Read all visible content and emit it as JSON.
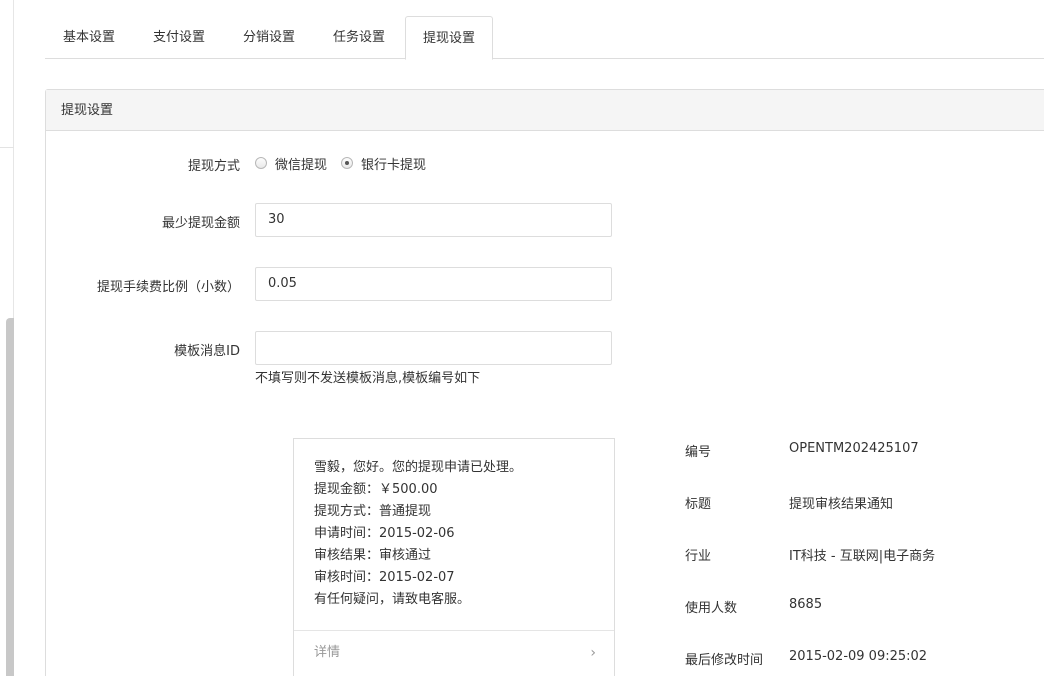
{
  "tabs": [
    {
      "label": "基本设置"
    },
    {
      "label": "支付设置"
    },
    {
      "label": "分销设置"
    },
    {
      "label": "任务设置"
    },
    {
      "label": "提现设置"
    }
  ],
  "active_tab": "提现设置",
  "panel": {
    "title": "提现设置"
  },
  "form": {
    "method": {
      "label": "提现方式",
      "options": [
        {
          "label": "微信提现",
          "checked": false
        },
        {
          "label": "银行卡提现",
          "checked": true
        }
      ]
    },
    "min_amount": {
      "label": "最少提现金额",
      "value": "30"
    },
    "fee_ratio": {
      "label": "提现手续费比例（小数）",
      "value": "0.05"
    },
    "template_id": {
      "label": "模板消息ID",
      "value": "",
      "help": "不填写则不发送模板消息,模板编号如下"
    }
  },
  "preview": {
    "lines": [
      "雪毅，您好。您的提现申请已处理。",
      "提现金额：￥500.00",
      "提现方式：普通提现",
      "申请时间：2015-02-06",
      "审核结果：审核通过",
      "审核时间：2015-02-07",
      "有任何疑问，请致电客服。"
    ],
    "detail_label": "详情"
  },
  "template_info": [
    {
      "key": "编号",
      "value": "OPENTM202425107"
    },
    {
      "key": "标题",
      "value": "提现审核结果通知"
    },
    {
      "key": "行业",
      "value": "IT科技 - 互联网|电子商务"
    },
    {
      "key": "使用人数",
      "value": "8685"
    },
    {
      "key": "最后修改时间",
      "value": "2015-02-09 09:25:02"
    }
  ]
}
